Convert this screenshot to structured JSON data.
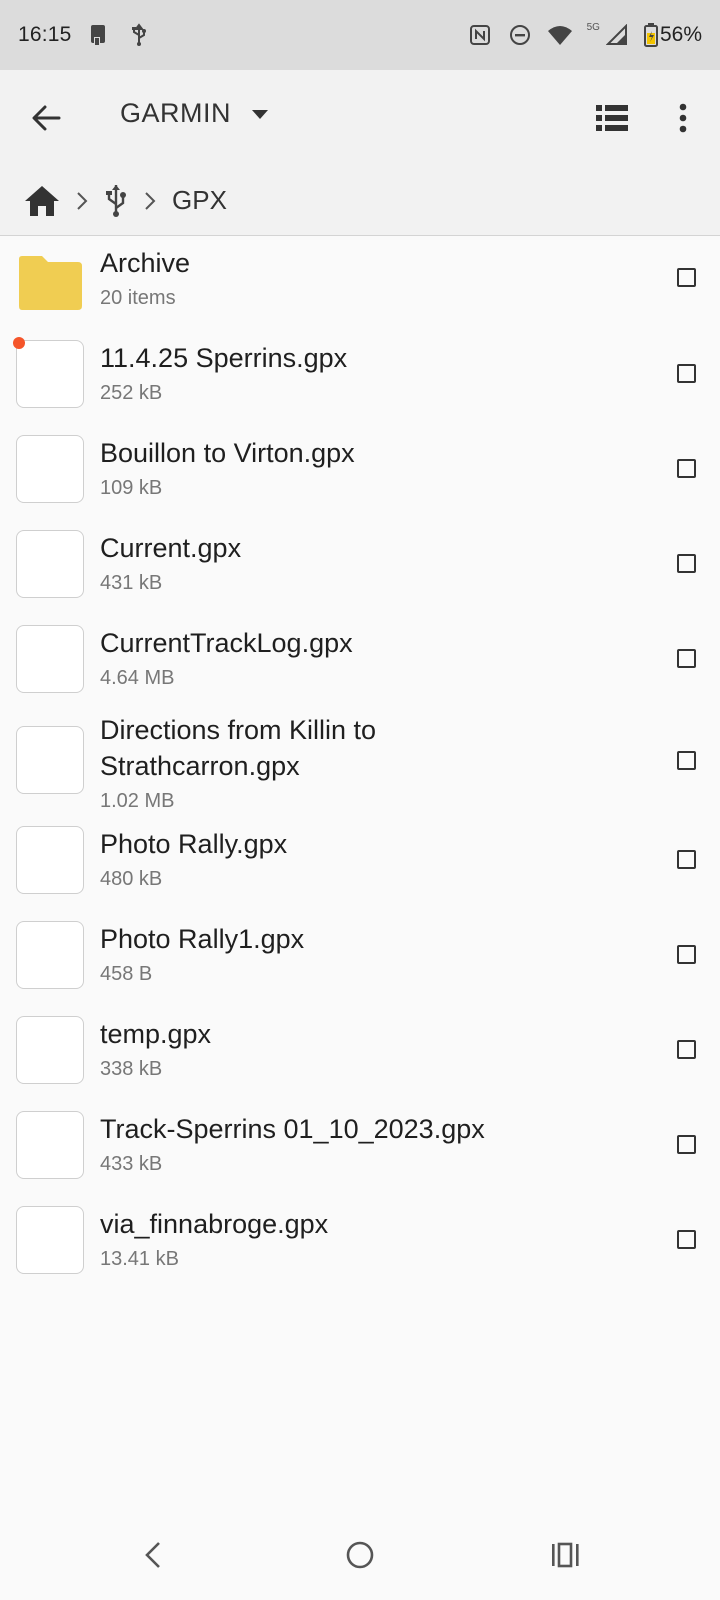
{
  "status_bar": {
    "time": "16:15",
    "battery_percent": "56%",
    "network_label": "5G",
    "icons": [
      "tablet-icon",
      "usb-icon",
      "nfc-icon",
      "do-not-disturb-icon",
      "wifi-icon",
      "signal-icon",
      "battery-icon"
    ]
  },
  "toolbar": {
    "title": "GARMIN",
    "icons": [
      "back-arrow-icon",
      "dropdown-caret-icon",
      "list-view-icon",
      "more-vert-icon"
    ]
  },
  "breadcrumb": {
    "current": "GPX",
    "icons": [
      "home-icon",
      "chevron-right-icon",
      "usb-icon"
    ]
  },
  "files": [
    {
      "name": "Archive",
      "meta": "20 items",
      "type": "folder"
    },
    {
      "name": "11.4.25 Sperrins.gpx",
      "meta": "252 kB",
      "type": "file",
      "new": true
    },
    {
      "name": "Bouillon to Virton.gpx",
      "meta": "109 kB",
      "type": "file"
    },
    {
      "name": "Current.gpx",
      "meta": "431 kB",
      "type": "file"
    },
    {
      "name": "CurrentTrackLog.gpx",
      "meta": "4.64 MB",
      "type": "file"
    },
    {
      "name": "Directions from Killin to Strathcarron.gpx",
      "meta": "1.02 MB",
      "type": "file"
    },
    {
      "name": "Photo Rally.gpx",
      "meta": "480 kB",
      "type": "file"
    },
    {
      "name": "Photo Rally1.gpx",
      "meta": "458 B",
      "type": "file"
    },
    {
      "name": "temp.gpx",
      "meta": "338 kB",
      "type": "file"
    },
    {
      "name": "Track-Sperrins  01_10_2023.gpx",
      "meta": "433 kB",
      "type": "file"
    },
    {
      "name": "via_finnabroge.gpx",
      "meta": "13.41 kB",
      "type": "file"
    }
  ],
  "navbar": {
    "icons": [
      "nav-back-icon",
      "nav-home-icon",
      "nav-recents-icon"
    ]
  },
  "colors": {
    "folder": "#f0cd52",
    "new_dot": "#f5552a",
    "status_bar_bg": "#dcdcdc",
    "toolbar_bg": "#f2f2f2"
  }
}
